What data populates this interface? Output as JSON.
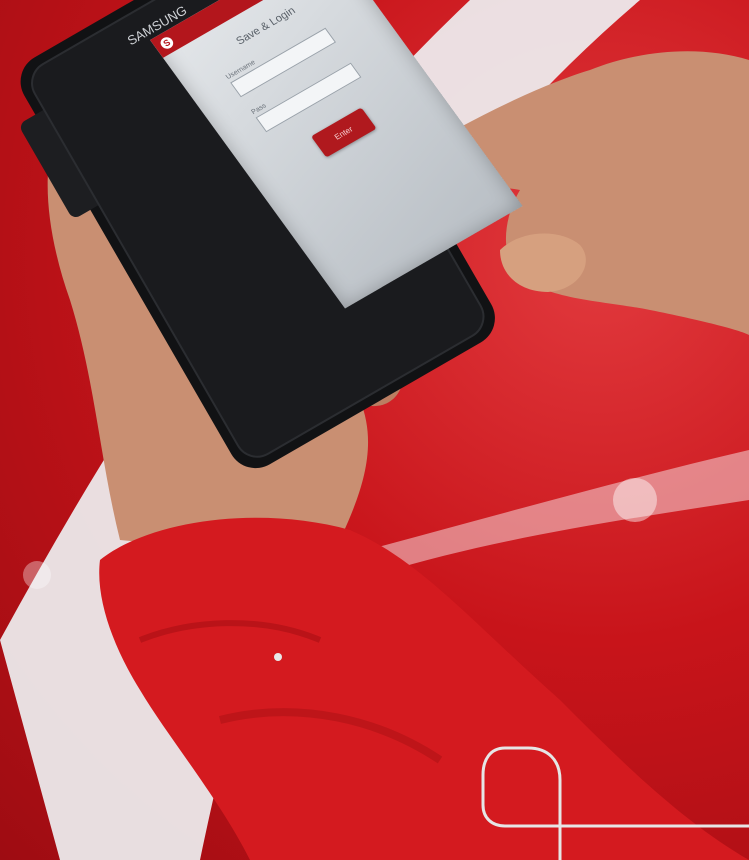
{
  "photo": {
    "subject": "hand-holding-smartphone",
    "phone_brand": "SAMSUNG",
    "colors": {
      "background_red": "#c8141a",
      "band_white": "#eef0f2",
      "sleeve_red": "#d41a1f",
      "phone_black": "#111214",
      "skin": "#c98f72"
    }
  },
  "screen": {
    "title": "Save & Login",
    "field1_label": "Username",
    "field1_value": "",
    "field2_label": "Pass",
    "field2_value": "",
    "button_label": "Enter"
  }
}
